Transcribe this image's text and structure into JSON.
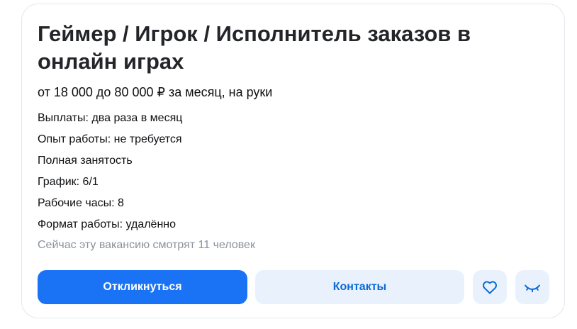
{
  "vacancy": {
    "title": "Геймер / Игрок / Исполнитель заказов в онлайн играх",
    "salary": "от 18 000 до 80 000 ₽ за месяц, на руки",
    "facts": [
      "Выплаты: два раза в месяц",
      "Опыт работы: не требуется",
      "Полная занятость",
      "График: 6/1",
      "Рабочие часы: 8",
      "Формат работы: удалённо"
    ],
    "viewers": "Сейчас эту вакансию смотрят 11 человек"
  },
  "actions": {
    "respond_label": "Откликнуться",
    "contacts_label": "Контакты",
    "favorite_icon": "heart-icon",
    "hide_icon": "closed-eye-icon"
  },
  "colors": {
    "primary": "#1a73f5",
    "secondary_bg": "#e9f2fc",
    "secondary_text": "#0d6ad6",
    "muted_text": "#8a929c"
  }
}
